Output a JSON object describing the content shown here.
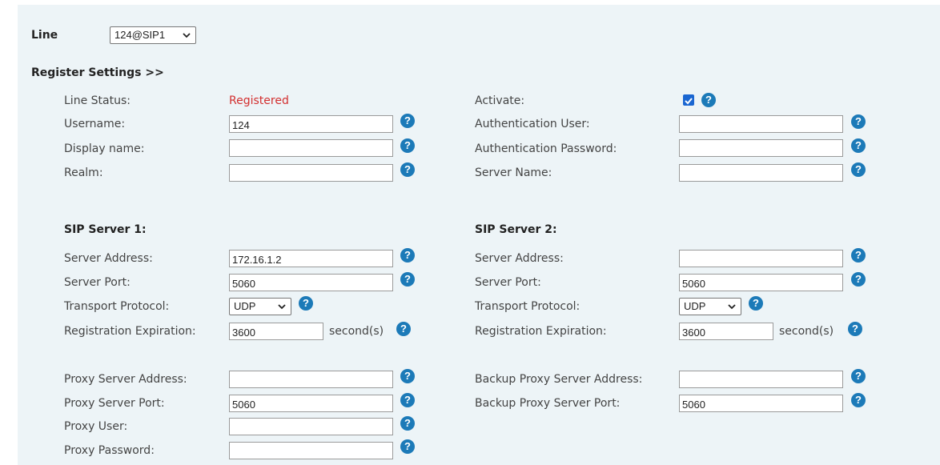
{
  "line": {
    "label": "Line",
    "selected": "124@SIP1"
  },
  "register_heading": "Register Settings >>",
  "left_top": {
    "line_status_label": "Line Status:",
    "line_status_value": "Registered",
    "username_label": "Username:",
    "username_value": "124",
    "display_name_label": "Display name:",
    "display_name_value": "",
    "realm_label": "Realm:",
    "realm_value": ""
  },
  "right_top": {
    "activate_label": "Activate:",
    "activate_checked": true,
    "auth_user_label": "Authentication User:",
    "auth_user_value": "",
    "auth_password_label": "Authentication Password:",
    "auth_password_value": "",
    "server_name_label": "Server Name:",
    "server_name_value": ""
  },
  "sip1": {
    "heading": "SIP Server 1:",
    "server_address_label": "Server Address:",
    "server_address_value": "172.16.1.2",
    "server_port_label": "Server Port:",
    "server_port_value": "5060",
    "transport_label": "Transport Protocol:",
    "transport_value": "UDP",
    "expiration_label": "Registration Expiration:",
    "expiration_value": "3600",
    "expiration_unit": "second(s)"
  },
  "sip2": {
    "heading": "SIP Server 2:",
    "server_address_label": "Server Address:",
    "server_address_value": "",
    "server_port_label": "Server Port:",
    "server_port_value": "5060",
    "transport_label": "Transport Protocol:",
    "transport_value": "UDP",
    "expiration_label": "Registration Expiration:",
    "expiration_value": "3600",
    "expiration_unit": "second(s)"
  },
  "proxy": {
    "address_label": "Proxy Server Address:",
    "address_value": "",
    "port_label": "Proxy Server Port:",
    "port_value": "5060",
    "user_label": "Proxy User:",
    "user_value": "",
    "password_label": "Proxy Password:",
    "password_value": ""
  },
  "backup_proxy": {
    "address_label": "Backup Proxy Server Address:",
    "address_value": "",
    "port_label": "Backup Proxy Server Port:",
    "port_value": "5060"
  },
  "help_glyph": "?",
  "colors": {
    "panel_bg": "#edf4f7",
    "status_red": "#d32f2f",
    "help_blue": "#1c7ab8",
    "checkbox_blue": "#1a66d1"
  }
}
